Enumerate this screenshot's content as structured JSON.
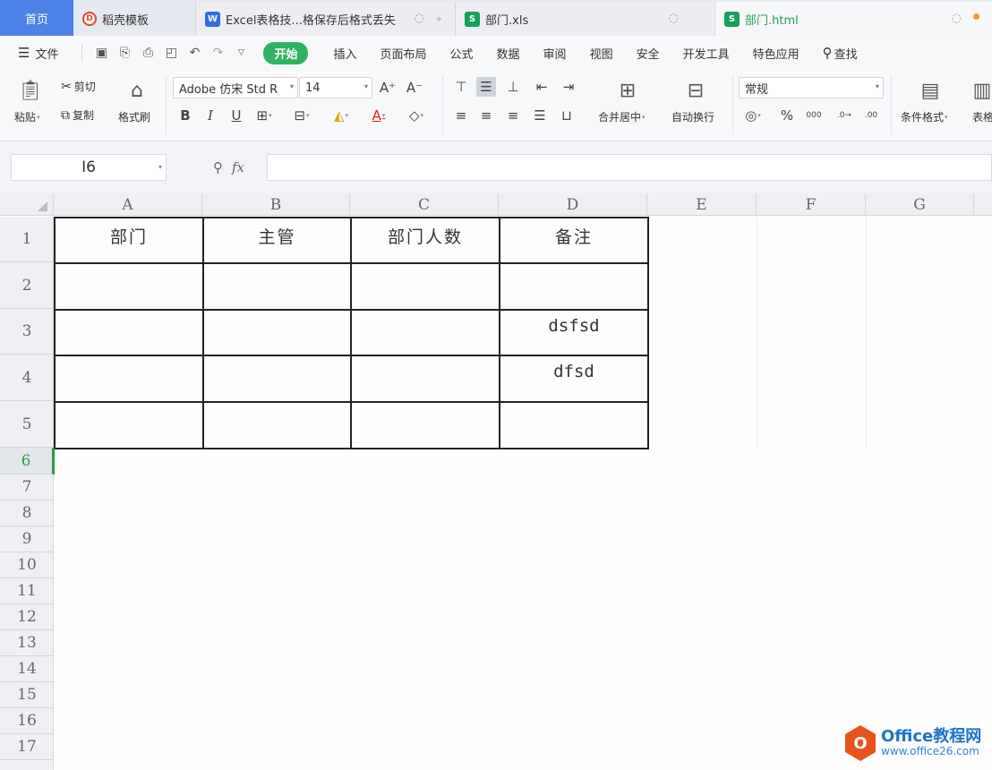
{
  "tabs": [
    {
      "label": "首页"
    },
    {
      "label": "稻壳模板",
      "icon": "wps-docer-icon"
    },
    {
      "label": "Excel表格技...格保存后格式丢失",
      "icon": "writer-doc-icon"
    },
    {
      "label": "部门.xls",
      "icon": "spreadsheet-icon"
    },
    {
      "label": "部门.html",
      "icon": "spreadsheet-icon"
    }
  ],
  "menu": {
    "file": "文件",
    "start": "开始",
    "items": [
      "插入",
      "页面布局",
      "公式",
      "数据",
      "审阅",
      "视图",
      "安全",
      "开发工具",
      "特色应用"
    ],
    "search": "查找"
  },
  "ribbon": {
    "paste": "粘贴",
    "cut": "剪切",
    "copy": "复制",
    "format_painter": "格式刷",
    "font_name": "Adobe 仿宋 Std R",
    "font_size": "14",
    "merge_center": "合并居中",
    "wrap_text": "自动换行",
    "number_format": "常规",
    "conditional_format": "条件格式",
    "table_style": "表格"
  },
  "formula_bar": {
    "cell_ref": "I6",
    "fx_label": "fx",
    "value": ""
  },
  "sheet": {
    "columns": [
      "A",
      "B",
      "C",
      "D",
      "E",
      "F",
      "G"
    ],
    "rows": [
      "1",
      "2",
      "3",
      "4",
      "5",
      "6",
      "7",
      "8",
      "9",
      "10",
      "11",
      "12",
      "13",
      "14",
      "15",
      "16",
      "17"
    ],
    "active_row": "6",
    "table": [
      [
        "部门",
        "主管",
        "部门人数",
        "备注"
      ],
      [
        "",
        "",
        "",
        ""
      ],
      [
        "",
        "",
        "",
        "dsfsd"
      ],
      [
        "",
        "",
        "",
        "dfsd"
      ],
      [
        "",
        "",
        "",
        ""
      ]
    ]
  },
  "watermark": {
    "line1": "Office教程网",
    "line2": "www.office26.com"
  }
}
